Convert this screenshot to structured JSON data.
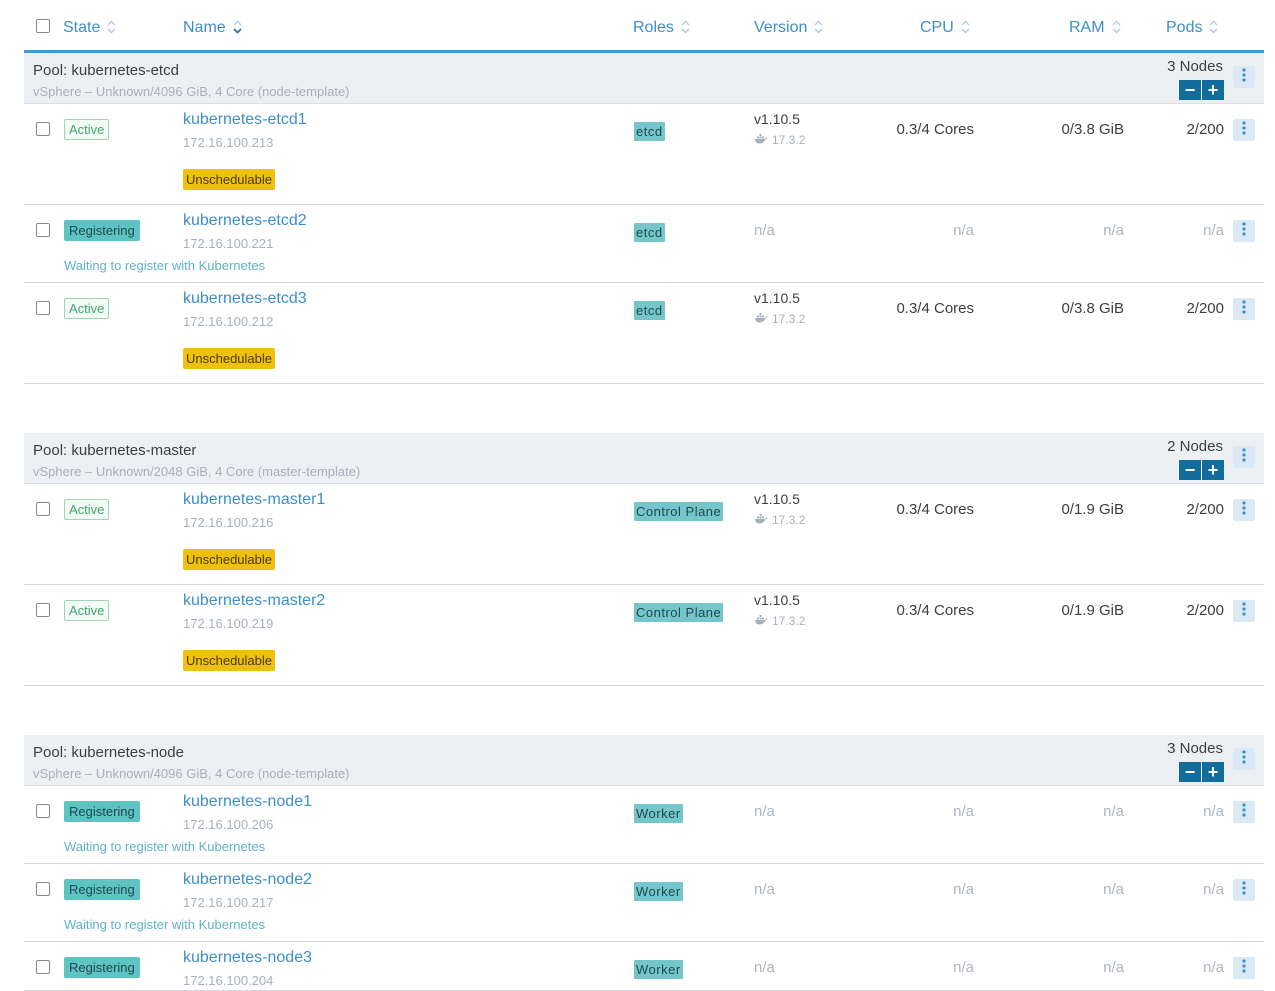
{
  "header": {
    "state": "State",
    "name": "Name",
    "roles": "Roles",
    "version": "Version",
    "cpu": "CPU",
    "ram": "RAM",
    "pods": "Pods"
  },
  "colors": {
    "accent": "#3d8fcc",
    "active_text": "#45a56b",
    "registering_bg": "#5ec3c3",
    "unschedulable_bg": "#efc10f",
    "role_bg": "#74c6ca",
    "scale_button": "#126d9c"
  },
  "pools": [
    {
      "title": "Pool: kubernetes-etcd",
      "subtitle": "vSphere – Unknown/4096 GiB, 4 Core (node-template)",
      "count": "3 Nodes",
      "nodes": [
        {
          "state": "Active",
          "name": "kubernetes-etcd1",
          "ip": "172.16.100.213",
          "role": "etcd",
          "version": "v1.10.5",
          "docker": "17.3.2",
          "cpu": "0.3/4 Cores",
          "ram": "0/3.8 GiB",
          "pods": "2/200",
          "badge": "Unschedulable",
          "message": ""
        },
        {
          "state": "Registering",
          "name": "kubernetes-etcd2",
          "ip": "172.16.100.221",
          "role": "etcd",
          "version": "n/a",
          "docker": "",
          "cpu": "n/a",
          "ram": "n/a",
          "pods": "n/a",
          "badge": "",
          "message": "Waiting to register with Kubernetes"
        },
        {
          "state": "Active",
          "name": "kubernetes-etcd3",
          "ip": "172.16.100.212",
          "role": "etcd",
          "version": "v1.10.5",
          "docker": "17.3.2",
          "cpu": "0.3/4 Cores",
          "ram": "0/3.8 GiB",
          "pods": "2/200",
          "badge": "Unschedulable",
          "message": ""
        }
      ]
    },
    {
      "title": "Pool: kubernetes-master",
      "subtitle": "vSphere – Unknown/2048 GiB, 4 Core (master-template)",
      "count": "2 Nodes",
      "nodes": [
        {
          "state": "Active",
          "name": "kubernetes-master1",
          "ip": "172.16.100.216",
          "role": "Control Plane",
          "version": "v1.10.5",
          "docker": "17.3.2",
          "cpu": "0.3/4 Cores",
          "ram": "0/1.9 GiB",
          "pods": "2/200",
          "badge": "Unschedulable",
          "message": ""
        },
        {
          "state": "Active",
          "name": "kubernetes-master2",
          "ip": "172.16.100.219",
          "role": "Control Plane",
          "version": "v1.10.5",
          "docker": "17.3.2",
          "cpu": "0.3/4 Cores",
          "ram": "0/1.9 GiB",
          "pods": "2/200",
          "badge": "Unschedulable",
          "message": ""
        }
      ]
    },
    {
      "title": "Pool: kubernetes-node",
      "subtitle": "vSphere – Unknown/4096 GiB, 4 Core (node-template)",
      "count": "3 Nodes",
      "nodes": [
        {
          "state": "Registering",
          "name": "kubernetes-node1",
          "ip": "172.16.100.206",
          "role": "Worker",
          "version": "n/a",
          "docker": "",
          "cpu": "n/a",
          "ram": "n/a",
          "pods": "n/a",
          "badge": "",
          "message": "Waiting to register with Kubernetes"
        },
        {
          "state": "Registering",
          "name": "kubernetes-node2",
          "ip": "172.16.100.217",
          "role": "Worker",
          "version": "n/a",
          "docker": "",
          "cpu": "n/a",
          "ram": "n/a",
          "pods": "n/a",
          "badge": "",
          "message": "Waiting to register with Kubernetes"
        },
        {
          "state": "Registering",
          "name": "kubernetes-node3",
          "ip": "172.16.100.204",
          "role": "Worker",
          "version": "n/a",
          "docker": "",
          "cpu": "n/a",
          "ram": "n/a",
          "pods": "n/a",
          "badge": "",
          "message": ""
        }
      ]
    }
  ]
}
